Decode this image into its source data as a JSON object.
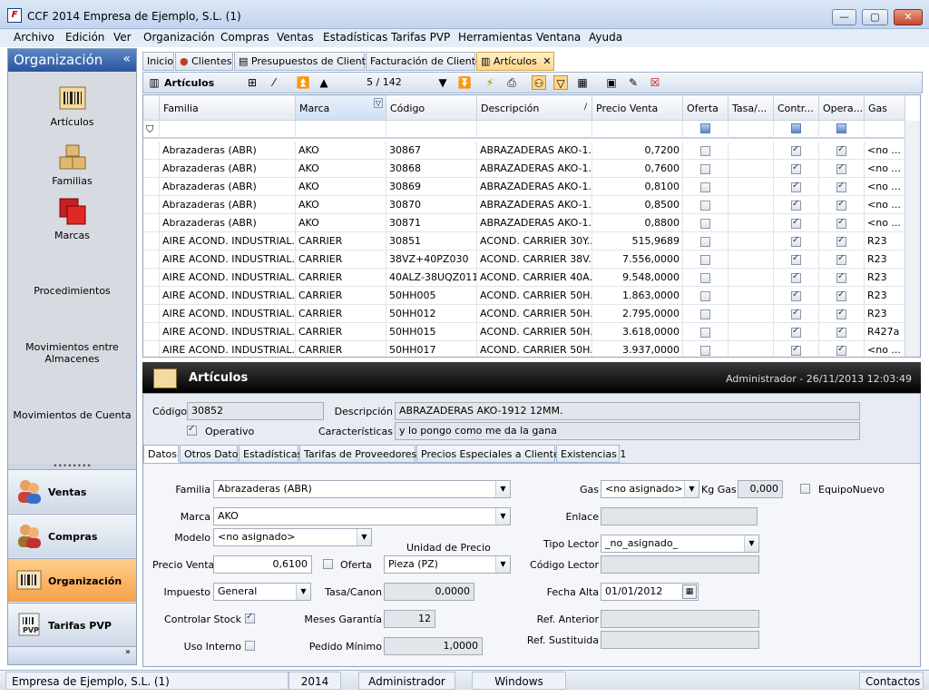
{
  "window": {
    "title": "CCF 2014 Empresa de Ejemplo, S.L. (1)",
    "minimize": "—",
    "maximize": "▢",
    "close": "✕"
  },
  "menu": [
    "Archivo",
    "Edición",
    "Ver",
    "Organización",
    "Compras",
    "Ventas",
    "Estadísticas",
    "Tarifas PVP",
    "Herramientas",
    "Ventana",
    "Ayuda"
  ],
  "sidebar": {
    "title": "Organización",
    "items": [
      {
        "label": "Artículos",
        "icon": "barcode-icon"
      },
      {
        "label": "Familias",
        "icon": "boxes-icon"
      },
      {
        "label": "Marcas",
        "icon": "red-squares-icon"
      },
      {
        "label": "Procedimientos"
      },
      {
        "label": "Movimientos entre Almacenes"
      },
      {
        "label": "Movimientos de Cuenta"
      }
    ],
    "nav": [
      {
        "label": "Ventas"
      },
      {
        "label": "Compras"
      },
      {
        "label": "Organización"
      },
      {
        "label": "Tarifas PVP"
      }
    ],
    "more": "»"
  },
  "tabs": [
    {
      "label": "Inicio"
    },
    {
      "label": "Clientes"
    },
    {
      "label": "Presupuestos de Cliente"
    },
    {
      "label": "Facturación de Clientes"
    },
    {
      "label": "Artículos"
    }
  ],
  "toolbar": {
    "title": "Artículos",
    "record": "5 / 142"
  },
  "grid": {
    "columns": [
      "Familia",
      "Marca",
      "Código",
      "Descripción",
      "Precio Venta",
      "Oferta",
      "Tasa/...",
      "Contr...",
      "Opera...",
      "Gas"
    ],
    "rows": [
      [
        "Abrazaderas (ABR)",
        "AKO",
        "30867",
        "ABRAZADERAS AKO-1...",
        "0,7200",
        false,
        "",
        true,
        true,
        "<no ..."
      ],
      [
        "Abrazaderas (ABR)",
        "AKO",
        "30868",
        "ABRAZADERAS AKO-1...",
        "0,7600",
        false,
        "",
        true,
        true,
        "<no ..."
      ],
      [
        "Abrazaderas (ABR)",
        "AKO",
        "30869",
        "ABRAZADERAS AKO-1...",
        "0,8100",
        false,
        "",
        true,
        true,
        "<no ..."
      ],
      [
        "Abrazaderas (ABR)",
        "AKO",
        "30870",
        "ABRAZADERAS AKO-1...",
        "0,8500",
        false,
        "",
        true,
        true,
        "<no ..."
      ],
      [
        "Abrazaderas (ABR)",
        "AKO",
        "30871",
        "ABRAZADERAS AKO-1...",
        "0,8800",
        false,
        "",
        true,
        true,
        "<no ..."
      ],
      [
        "AIRE ACOND. INDUSTRIAL...",
        "CARRIER",
        "30851",
        "ACOND. CARRIER 30Y...",
        "515,9689",
        false,
        "",
        true,
        true,
        "R23"
      ],
      [
        "AIRE ACOND. INDUSTRIAL...",
        "CARRIER",
        "38VZ+40PZ030",
        "ACOND. CARRIER 38V...",
        "7.556,0000",
        false,
        "",
        true,
        true,
        "R23"
      ],
      [
        "AIRE ACOND. INDUSTRIAL...",
        "CARRIER",
        "40ALZ-38UQZ011",
        "ACOND. CARRIER 40A...",
        "9.548,0000",
        false,
        "",
        true,
        true,
        "R23"
      ],
      [
        "AIRE ACOND. INDUSTRIAL...",
        "CARRIER",
        "50HH005",
        "ACOND. CARRIER 50H...",
        "1.863,0000",
        false,
        "",
        true,
        true,
        "R23"
      ],
      [
        "AIRE ACOND. INDUSTRIAL...",
        "CARRIER",
        "50HH012",
        "ACOND. CARRIER 50H...",
        "2.795,0000",
        false,
        "",
        true,
        true,
        "R23"
      ],
      [
        "AIRE ACOND. INDUSTRIAL...",
        "CARRIER",
        "50HH015",
        "ACOND. CARRIER 50H...",
        "3.618,0000",
        false,
        "",
        true,
        true,
        "R427a"
      ],
      [
        "AIRE ACOND. INDUSTRIAL...",
        "CARRIER",
        "50HH017",
        "ACOND. CARRIER 50H...",
        "3.937,0000",
        false,
        "",
        true,
        true,
        "<no ..."
      ]
    ]
  },
  "detail": {
    "title": "Artículos",
    "user_stamp": "Administrador - 26/11/2013 12:03:49",
    "codigo_label": "Código",
    "codigo": "30852",
    "descripcion_label": "Descripción",
    "descripcion": "ABRAZADERAS AKO-1912 12MM.",
    "operativo_label": "Operativo",
    "caracteristicas_label": "Características",
    "caracteristicas": "y lo pongo como me da la gana",
    "tabs": [
      "Datos",
      "Otros Datos",
      "Estadísticas",
      "Tarifas de Proveedores 0",
      "Precios Especiales a Clientes 0",
      "Existencias 1"
    ],
    "familia_label": "Familia",
    "familia": "Abrazaderas (ABR)",
    "marca_label": "Marca",
    "marca": "AKO",
    "modelo_label": "Modelo",
    "modelo": "<no asignado>",
    "precio_label": "Precio Venta",
    "precio": "0,6100",
    "oferta_label": "Oferta",
    "unidad_label": "Unidad de Precio",
    "unidad": "Pieza (PZ)",
    "impuesto_label": "Impuesto",
    "impuesto": "General",
    "tasa_label": "Tasa/Canon",
    "tasa": "0,0000",
    "controlar_label": "Controlar Stock",
    "garantia_label": "Meses Garantía",
    "garantia": "12",
    "uso_label": "Uso Interno",
    "pedido_label": "Pedido Mínimo",
    "pedido": "1,0000",
    "gas_label": "Gas",
    "gas": "<no asignado>",
    "kggas_label": "Kg Gas",
    "kggas": "0,000",
    "equipo_label": "EquipoNuevo",
    "enlace_label": "Enlace",
    "tipolector_label": "Tipo Lector",
    "tipolector": "_no_asignado_",
    "codlector_label": "Código Lector",
    "fecha_label": "Fecha Alta",
    "fecha": "01/01/2012",
    "refant_label": "Ref. Anterior",
    "refsus_label": "Ref. Sustituida"
  },
  "status": [
    "Empresa de Ejemplo, S.L. (1)",
    "2014",
    "Administrador",
    "Windows",
    "Contactos"
  ]
}
